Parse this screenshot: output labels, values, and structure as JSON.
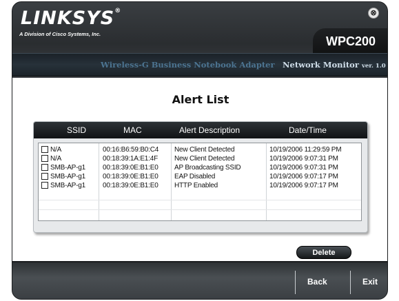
{
  "header": {
    "logo_text": "LINKSYS",
    "logo_reg": "®",
    "tagline": "A Division of Cisco Systems, Inc.",
    "close_symbol": "⊗",
    "model": "WPC200",
    "product_name": "Wireless-G Business Notebook Adapter",
    "monitor_label": "Network Monitor",
    "version": "ver. 1.0"
  },
  "alert_list": {
    "title": "Alert List",
    "columns": [
      "SSID",
      "MAC",
      "Alert Description",
      "Date/Time"
    ],
    "rows": [
      {
        "ssid": "N/A",
        "mac": "00:16:B6:59:B0:C4",
        "description": "New Client Detected",
        "datetime": "10/19/2006 11:29:59 PM"
      },
      {
        "ssid": "N/A",
        "mac": "00:18:39:1A:E1:4F",
        "description": "New Client Detected",
        "datetime": "10/19/2006 9:07:31 PM"
      },
      {
        "ssid": "SMB-AP-g1",
        "mac": "00:18:39:0E:B1:E0",
        "description": "AP Broadcasting SSID",
        "datetime": "10/19/2006 9:07:31 PM"
      },
      {
        "ssid": "SMB-AP-g1",
        "mac": "00:18:39:0E:B1:E0",
        "description": "EAP Disabled",
        "datetime": "10/19/2006 9:07:17 PM"
      },
      {
        "ssid": "SMB-AP-g1",
        "mac": "00:18:39:0E:B1:E0",
        "description": "HTTP Enabled",
        "datetime": "10/19/2006 9:07:17 PM"
      }
    ],
    "delete_label": "Delete"
  },
  "footer": {
    "back_label": "Back",
    "exit_label": "Exit"
  }
}
